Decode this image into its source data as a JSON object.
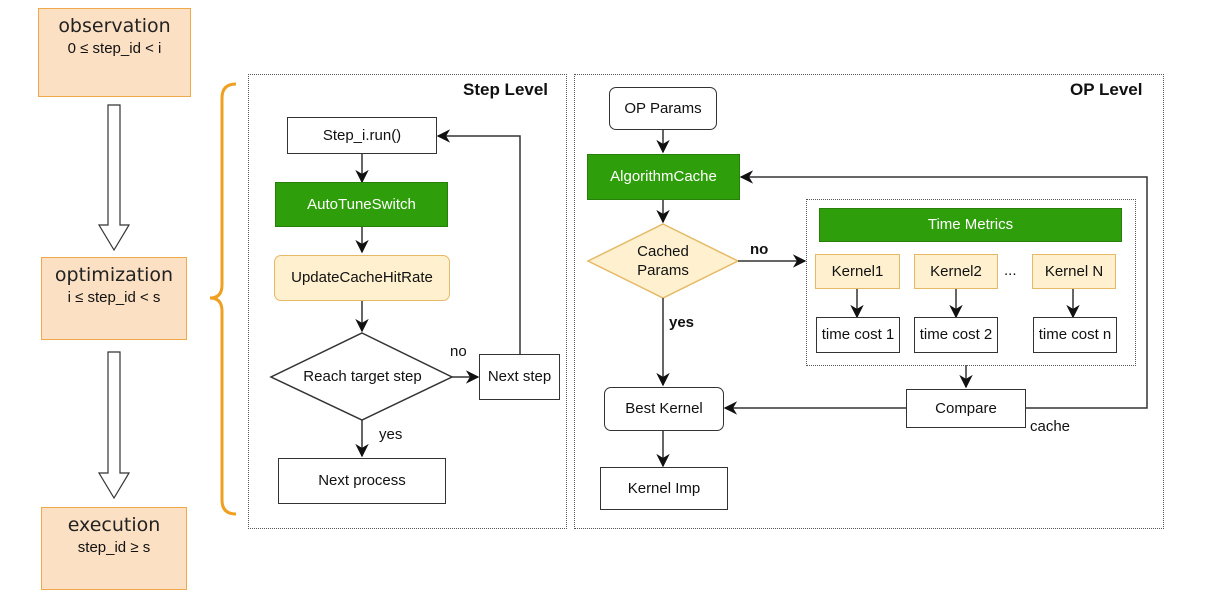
{
  "phases": [
    {
      "name": "observation",
      "condition": "0 ≤ step_id < i"
    },
    {
      "name": "optimization",
      "condition": "i ≤ step_id < s"
    },
    {
      "name": "execution",
      "condition": "step_id ≥ s"
    }
  ],
  "step_level": {
    "title": "Step Level",
    "run": "Step_i.run()",
    "switch": "AutoTuneSwitch",
    "update": "UpdateCacheHitRate",
    "decision": "Reach target step",
    "no_label": "no",
    "yes_label": "yes",
    "next_step": "Next step",
    "next_process": "Next process"
  },
  "op_level": {
    "title": "OP Level",
    "params": "OP Params",
    "cache": "AlgorithmCache",
    "decision_line1": "Cached",
    "decision_line2": "Params",
    "no_label": "no",
    "yes_label": "yes",
    "time_metrics": "Time Metrics",
    "kernels": [
      "Kernel1",
      "Kernel2",
      "Kernel N"
    ],
    "ellipsis": "...",
    "time_costs": [
      "time cost 1",
      "time cost 2",
      "time cost n"
    ],
    "compare": "Compare",
    "cache_label": "cache",
    "best_kernel": "Best Kernel",
    "kernel_imp": "Kernel Imp"
  },
  "colors": {
    "phase_fill": "#fce0c4",
    "phase_border": "#f0a94a",
    "green": "#2f9e0b",
    "yellow_fill": "#fff1cf",
    "yellow_border": "#e5b965",
    "brace": "#f0a020"
  }
}
